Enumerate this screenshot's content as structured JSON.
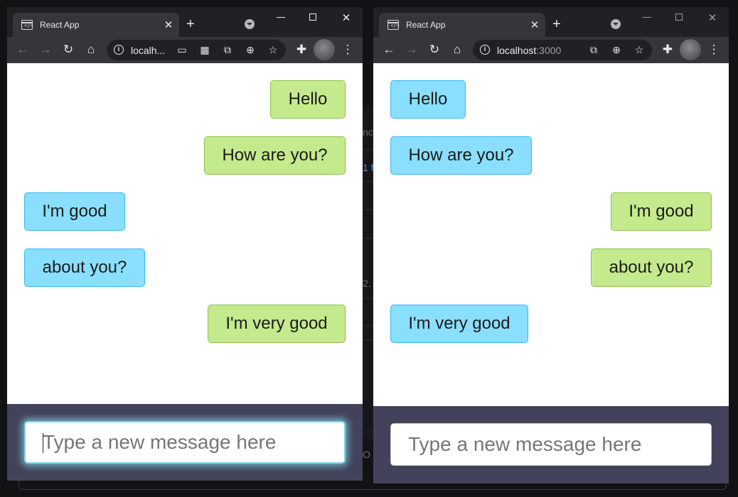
{
  "background": {
    "fragments": [
      "nc",
      "1 f",
      "2.",
      "O"
    ],
    "colors": {
      "desktop": "#111214",
      "link": "#4a8df0"
    }
  },
  "windows": [
    {
      "tab": {
        "title": "React App",
        "close": "✕"
      },
      "new_tab": "+",
      "controls": {
        "minimize": "minimize-icon",
        "maximize": "maximize-icon",
        "close": "✕"
      },
      "address": {
        "url": "localh...",
        "port": ""
      },
      "messages": [
        {
          "text": "Hello",
          "side": "right"
        },
        {
          "text": "How are you?",
          "side": "right"
        },
        {
          "text": "I'm good",
          "side": "left"
        },
        {
          "text": "about you?",
          "side": "left"
        },
        {
          "text": "I'm very good",
          "side": "right"
        }
      ],
      "composer": {
        "placeholder": "Type a new message here",
        "value": "",
        "focused": true
      }
    },
    {
      "tab": {
        "title": "React App",
        "close": "✕"
      },
      "new_tab": "+",
      "controls": {
        "minimize": "minimize-icon",
        "maximize": "maximize-icon",
        "close": "✕"
      },
      "address": {
        "url": "localhost",
        "port": ":3000"
      },
      "messages": [
        {
          "text": "Hello",
          "side": "left"
        },
        {
          "text": "How are you?",
          "side": "left"
        },
        {
          "text": "I'm good",
          "side": "right"
        },
        {
          "text": "about you?",
          "side": "right"
        },
        {
          "text": "I'm very good",
          "side": "left"
        }
      ],
      "composer": {
        "placeholder": "Type a new message here",
        "value": "",
        "focused": false
      }
    }
  ],
  "colors": {
    "sent_bubble": "#c5ea8d",
    "received_bubble": "#8adfff",
    "composer_bar": "#42435a",
    "browser_frame": "#202124",
    "toolbar": "#35363a"
  }
}
